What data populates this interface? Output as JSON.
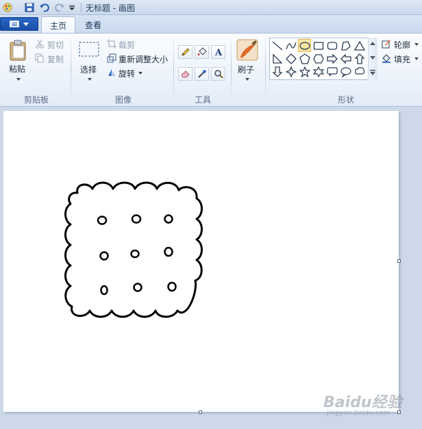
{
  "window": {
    "title": "无标题 - 画图"
  },
  "tabs": [
    {
      "label": "主页",
      "active": true
    },
    {
      "label": "查看",
      "active": false
    }
  ],
  "ribbon": {
    "clipboard": {
      "group_label": "剪贴板",
      "paste_label": "粘贴",
      "cut_label": "剪切",
      "copy_label": "复制"
    },
    "image": {
      "group_label": "图像",
      "select_label": "选择",
      "crop_label": "裁剪",
      "resize_label": "重新调整大小",
      "rotate_label": "旋转"
    },
    "tools": {
      "group_label": "工具",
      "items": [
        "pencil-icon",
        "fill-bucket-icon",
        "text-icon",
        "eraser-icon",
        "color-picker-icon",
        "magnifier-icon"
      ]
    },
    "brushes": {
      "label": "刷子"
    },
    "shapes": {
      "group_label": "形状",
      "outline_label": "轮廓",
      "fill_label": "填充",
      "selected_shape": "oval"
    }
  },
  "watermark": {
    "text": "Baidu经验",
    "sub": "jingyan.baidu.com"
  },
  "colors": {
    "accent": "#1a4ea8",
    "ribbon_bg": "#eef4fb",
    "canvas_bg": "#ffffff",
    "workspace_bg": "#cdd9e9",
    "selection_highlight": "#fde7a5"
  }
}
